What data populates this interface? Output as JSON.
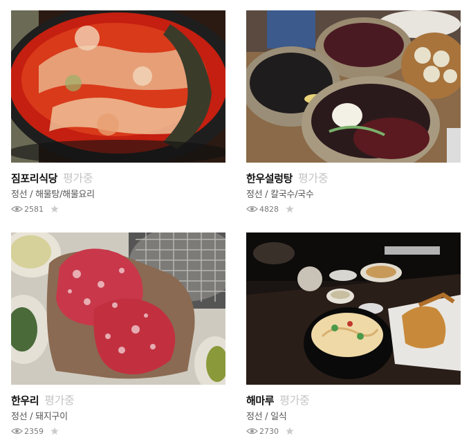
{
  "restaurants": [
    {
      "name": "짐포리식당",
      "rating": "평가중",
      "region": "정선",
      "category": "해물탕/해물요리",
      "views": "2581",
      "photo_icon": "spicy-fish-stew-photo"
    },
    {
      "name": "한우설렁탕",
      "rating": "평가중",
      "region": "정선",
      "category": "칼국수/국수",
      "views": "4828",
      "photo_icon": "noodle-bowls-photo"
    },
    {
      "name": "한우리",
      "rating": "평가중",
      "region": "정선",
      "category": "돼지구이",
      "views": "2359",
      "photo_icon": "raw-beef-grill-photo"
    },
    {
      "name": "해마루",
      "rating": "평가중",
      "region": "정선",
      "category": "일식",
      "views": "2730",
      "photo_icon": "udon-tempura-photo"
    }
  ],
  "separator": "/",
  "icons": {
    "views": "eye-icon",
    "favorite": "star-icon"
  },
  "colors": {
    "title": "#111111",
    "rating": "#c4c4c4",
    "meta": "#555555",
    "stats": "#777777",
    "star": "#cccccc"
  }
}
